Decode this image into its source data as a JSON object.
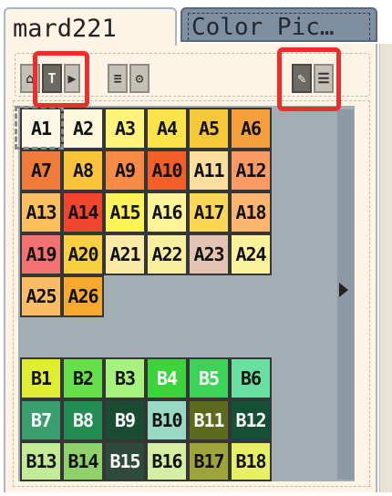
{
  "tabs": {
    "active": "mard221",
    "inactive": "Color Pic…"
  },
  "toolbar": {
    "buttons": [
      {
        "name": "lock-button",
        "glyph": "⌂",
        "active": false
      },
      {
        "name": "text-button",
        "glyph": "T",
        "active": true
      },
      {
        "name": "next-button",
        "glyph": "▶",
        "active": false
      },
      {
        "name": "align-button",
        "glyph": "≡",
        "active": false
      },
      {
        "name": "gear-button",
        "glyph": "⚙",
        "active": false
      },
      {
        "name": "edit-button",
        "glyph": "✎",
        "active": true
      },
      {
        "name": "menu-button",
        "glyph": "☰",
        "active": false
      }
    ]
  },
  "palette_a": [
    {
      "label": "A1",
      "bg": "#fbf6e6",
      "fg": "#111111"
    },
    {
      "label": "A2",
      "bg": "#fdf8dc",
      "fg": "#111111"
    },
    {
      "label": "A3",
      "bg": "#fff47a",
      "fg": "#111111"
    },
    {
      "label": "A4",
      "bg": "#fde249",
      "fg": "#111111"
    },
    {
      "label": "A5",
      "bg": "#f5c93a",
      "fg": "#111111"
    },
    {
      "label": "A6",
      "bg": "#f6a03d",
      "fg": "#111111"
    },
    {
      "label": "A7",
      "bg": "#ef7c3a",
      "fg": "#111111"
    },
    {
      "label": "A8",
      "bg": "#fbc53b",
      "fg": "#111111"
    },
    {
      "label": "A9",
      "bg": "#f78b45",
      "fg": "#111111"
    },
    {
      "label": "A10",
      "bg": "#f45f27",
      "fg": "#111111"
    },
    {
      "label": "A11",
      "bg": "#fcdf9c",
      "fg": "#111111"
    },
    {
      "label": "A12",
      "bg": "#fb9a63",
      "fg": "#111111"
    },
    {
      "label": "A13",
      "bg": "#fbbf5f",
      "fg": "#111111"
    },
    {
      "label": "A14",
      "bg": "#f2452d",
      "fg": "#111111"
    },
    {
      "label": "A15",
      "bg": "#fdf25a",
      "fg": "#111111"
    },
    {
      "label": "A16",
      "bg": "#fdf49a",
      "fg": "#111111"
    },
    {
      "label": "A17",
      "bg": "#fbd759",
      "fg": "#111111"
    },
    {
      "label": "A18",
      "bg": "#fbb56f",
      "fg": "#111111"
    },
    {
      "label": "A19",
      "bg": "#f57070",
      "fg": "#111111"
    },
    {
      "label": "A20",
      "bg": "#f9d042",
      "fg": "#111111"
    },
    {
      "label": "A21",
      "bg": "#fbe9a6",
      "fg": "#111111"
    },
    {
      "label": "A22",
      "bg": "#f8f09c",
      "fg": "#111111"
    },
    {
      "label": "A23",
      "bg": "#e4c5b3",
      "fg": "#111111"
    },
    {
      "label": "A24",
      "bg": "#fcf29c",
      "fg": "#111111"
    },
    {
      "label": "A25",
      "bg": "#fbbc66",
      "fg": "#111111"
    },
    {
      "label": "A26",
      "bg": "#f5aa2e",
      "fg": "#111111"
    }
  ],
  "palette_b": [
    {
      "label": "B1",
      "bg": "#ddee33",
      "fg": "#111111"
    },
    {
      "label": "B2",
      "bg": "#66e048",
      "fg": "#111111"
    },
    {
      "label": "B3",
      "bg": "#a5f27d",
      "fg": "#111111"
    },
    {
      "label": "B4",
      "bg": "#3bd43b",
      "fg": "#ffffff"
    },
    {
      "label": "B5",
      "bg": "#3bd458",
      "fg": "#ffffff"
    },
    {
      "label": "B6",
      "bg": "#68e1a0",
      "fg": "#111111"
    },
    {
      "label": "B7",
      "bg": "#3a9e6e",
      "fg": "#ffffff"
    },
    {
      "label": "B8",
      "bg": "#228c52",
      "fg": "#ffffff"
    },
    {
      "label": "B9",
      "bg": "#1a4b33",
      "fg": "#ffffff"
    },
    {
      "label": "B10",
      "bg": "#9ad9c4",
      "fg": "#111111"
    },
    {
      "label": "B11",
      "bg": "#5c6a1e",
      "fg": "#ffffff"
    },
    {
      "label": "B12",
      "bg": "#154f35",
      "fg": "#ffffff"
    },
    {
      "label": "B13",
      "bg": "#c3ea97",
      "fg": "#111111"
    },
    {
      "label": "B14",
      "bg": "#8fd16b",
      "fg": "#111111"
    },
    {
      "label": "B15",
      "bg": "#2e4a3c",
      "fg": "#ffffff"
    },
    {
      "label": "B16",
      "bg": "#d4eea3",
      "fg": "#111111"
    },
    {
      "label": "B17",
      "bg": "#9fa43a",
      "fg": "#111111"
    },
    {
      "label": "B18",
      "bg": "#e7ef66",
      "fg": "#111111"
    }
  ]
}
